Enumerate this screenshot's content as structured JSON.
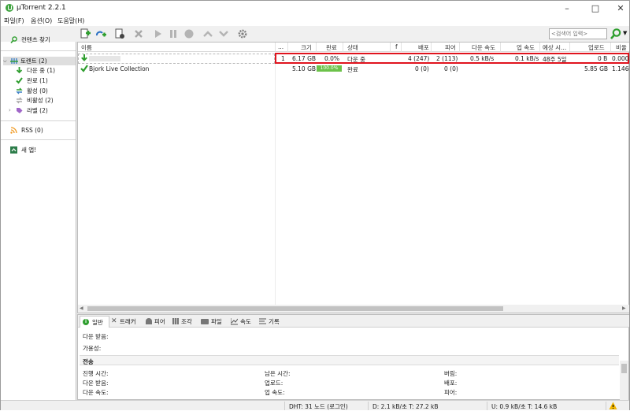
{
  "window": {
    "title": "µTorrent 2.2.1"
  },
  "menu": [
    "파일(F)",
    "옵션(O)",
    "도움말(H)"
  ],
  "search": {
    "placeholder": "<검색어 입력>"
  },
  "sidebar": {
    "find_content": "컨텐츠 찾기",
    "torrents": "토렌트 (2)",
    "downloading": "다운 중 (1)",
    "completed": "완료 (1)",
    "active": "활성 (0)",
    "inactive": "비활성 (2)",
    "labels": "라벨 (2)",
    "rss": "RSS (0)",
    "new_app": "새 앱!"
  },
  "columns": {
    "name": "이름",
    "num": "...",
    "size": "크기",
    "done": "완료",
    "status": "상태",
    "flag": "f",
    "seeds": "배포",
    "peers": "피어",
    "down": "다운 속도",
    "up": "업 속도",
    "eta": "예상 시...",
    "uploaded": "업로드",
    "ratio": "비율"
  },
  "torrents": [
    {
      "name": "",
      "num": "1",
      "size": "6.17 GB",
      "done": "0.0%",
      "progress": 0.0,
      "status": "다운 중",
      "seeds": "4 (247)",
      "peers": "2 (113)",
      "down": "0.5 kB/s",
      "up": "0.1 kB/s",
      "eta": "48주 5일",
      "uploaded": "0 B",
      "ratio": "0.000"
    },
    {
      "name": "Bjork Live Collection",
      "num": "",
      "size": "5.10 GB",
      "done": "100.0%",
      "progress": 1.0,
      "status": "완료",
      "seeds": "0 (0)",
      "peers": "0 (0)",
      "down": "",
      "up": "",
      "eta": "",
      "uploaded": "5.85 GB",
      "ratio": "1.146"
    }
  ],
  "detail_tabs": [
    "일반",
    "트래커",
    "피어",
    "조각",
    "파일",
    "속도",
    "기록"
  ],
  "detail": {
    "downloaded_label": "다운 받음:",
    "availability_label": "가용성:",
    "transfer_header": "전송",
    "elapsed": "진행 시간:",
    "remaining": "남은 시간:",
    "wasted": "버림:",
    "dl": "다운 받음:",
    "ul": "업로드:",
    "seeds": "배포:",
    "dl_speed": "다운 속도:",
    "ul_speed": "업 속도:",
    "peers": "피어:"
  },
  "status": {
    "dht": "DHT: 31 노드  (로그인)",
    "down": "D: 2.1 kB/초 T: 27.2 kB",
    "up": "U: 0.9 kB/초 T: 14.6 kB"
  },
  "colors": {
    "accent": "#3fa33f",
    "highlight": "#e0141e",
    "progress": "#6cc24a"
  }
}
